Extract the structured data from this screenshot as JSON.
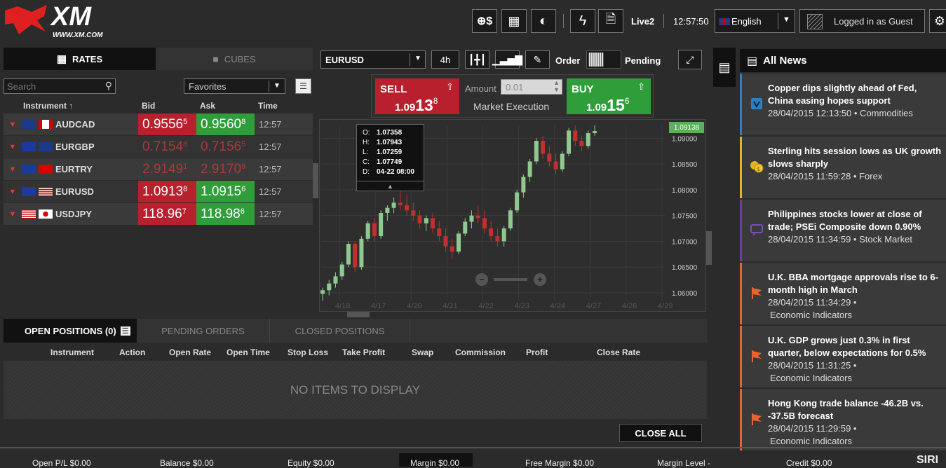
{
  "header": {
    "logo_text": "XM",
    "logo_url": "WWW.XM.COM",
    "account": "Live2",
    "clock": "12:57:50",
    "language": "English",
    "login_label": "Logged in as Guest"
  },
  "rates_panel": {
    "tab_rates": "RATES",
    "tab_cubes": "CUBES",
    "search_placeholder": "Search",
    "filter": "Favorites",
    "headers": {
      "instrument": "Instrument",
      "bid": "Bid",
      "ask": "Ask",
      "time": "Time"
    },
    "rows": [
      {
        "symbol": "AUDCAD",
        "bid_main": "0.9556",
        "bid_pip": "5",
        "ask_main": "0.9560",
        "ask_pip": "8",
        "time": "12:57",
        "active": true
      },
      {
        "symbol": "EURGBP",
        "bid_main": "0.7154",
        "bid_pip": "8",
        "ask_main": "0.7156",
        "ask_pip": "5",
        "time": "12:57",
        "active": false
      },
      {
        "symbol": "EURTRY",
        "bid_main": "2.9149",
        "bid_pip": "1",
        "ask_main": "2.9170",
        "ask_pip": "9",
        "time": "12:57",
        "active": false
      },
      {
        "symbol": "EURUSD",
        "bid_main": "1.0913",
        "bid_pip": "8",
        "ask_main": "1.0915",
        "ask_pip": "6",
        "time": "12:57",
        "active": true
      },
      {
        "symbol": "USDJPY",
        "bid_main": "118.96",
        "bid_pip": "7",
        "ask_main": "118.98",
        "ask_pip": "6",
        "time": "12:57",
        "active": true
      }
    ]
  },
  "chart_panel": {
    "symbol": "EURUSD",
    "timeframe": "4h",
    "order_label": "Order",
    "pending_label": "Pending",
    "sell": {
      "label": "SELL",
      "pre": "1.09",
      "big": "13",
      "pip": "8"
    },
    "buy": {
      "label": "BUY",
      "pre": "1.09",
      "big": "15",
      "pip": "6"
    },
    "amount_label": "Amount",
    "amount_value": "0.01",
    "execution": "Market Execution",
    "current_price": "1.09138",
    "tooltip": {
      "o": "1.07358",
      "h": "1.07943",
      "l": "1.07259",
      "c": "1.07749",
      "d": "04-22 08:00",
      "lo": "O:",
      "lh": "H:",
      "ll": "L:",
      "lc": "C:",
      "ld": "D:"
    }
  },
  "chart_data": {
    "type": "candlestick",
    "y_ticks": [
      "1.09000",
      "1.08500",
      "1.08000",
      "1.07500",
      "1.07000",
      "1.06500",
      "1.06000"
    ],
    "ylim": [
      1.0585,
      1.0925
    ],
    "x_ticks": [
      "4/18",
      "4/17",
      "4/20",
      "4/21",
      "4/22",
      "4/23",
      "4/24",
      "4/27",
      "4/28",
      "4/29"
    ],
    "ohlc": [
      [
        1.0598,
        1.061,
        1.0585,
        1.0605
      ],
      [
        1.0605,
        1.0625,
        1.0595,
        1.0618
      ],
      [
        1.0618,
        1.064,
        1.061,
        1.0632
      ],
      [
        1.0632,
        1.066,
        1.0625,
        1.0655
      ],
      [
        1.0655,
        1.07,
        1.065,
        1.0695
      ],
      [
        1.0695,
        1.07,
        1.064,
        1.065
      ],
      [
        1.065,
        1.071,
        1.0645,
        1.0705
      ],
      [
        1.0705,
        1.074,
        1.07,
        1.0735
      ],
      [
        1.0735,
        1.0745,
        1.07,
        1.071
      ],
      [
        1.071,
        1.076,
        1.0705,
        1.0755
      ],
      [
        1.0755,
        1.077,
        1.074,
        1.0765
      ],
      [
        1.0765,
        1.0785,
        1.0755,
        1.0775
      ],
      [
        1.0775,
        1.08,
        1.076,
        1.077
      ],
      [
        1.077,
        1.079,
        1.075,
        1.076
      ],
      [
        1.076,
        1.0775,
        1.074,
        1.075
      ],
      [
        1.075,
        1.076,
        1.0725,
        1.0735
      ],
      [
        1.0735,
        1.075,
        1.072,
        1.0745
      ],
      [
        1.0745,
        1.0755,
        1.0715,
        1.0725
      ],
      [
        1.0725,
        1.074,
        1.07,
        1.071
      ],
      [
        1.071,
        1.0725,
        1.068,
        1.069
      ],
      [
        1.069,
        1.0705,
        1.0665,
        1.068
      ],
      [
        1.068,
        1.072,
        1.0675,
        1.0715
      ],
      [
        1.0715,
        1.0745,
        1.071,
        1.0738
      ],
      [
        1.0738,
        1.076,
        1.0725,
        1.075
      ],
      [
        1.075,
        1.077,
        1.0735,
        1.0745
      ],
      [
        1.0745,
        1.076,
        1.0715,
        1.0725
      ],
      [
        1.0725,
        1.074,
        1.07,
        1.071
      ],
      [
        1.071,
        1.0725,
        1.069,
        1.07
      ],
      [
        1.07,
        1.073,
        1.069,
        1.0725
      ],
      [
        1.0725,
        1.0765,
        1.072,
        1.076
      ],
      [
        1.076,
        1.08,
        1.0755,
        1.0795
      ],
      [
        1.0795,
        1.083,
        1.0785,
        1.0825
      ],
      [
        1.0825,
        1.086,
        1.0815,
        1.0855
      ],
      [
        1.0855,
        1.09,
        1.085,
        1.0895
      ],
      [
        1.0895,
        1.0905,
        1.086,
        1.087
      ],
      [
        1.087,
        1.0885,
        1.0845,
        1.0855
      ],
      [
        1.0855,
        1.087,
        1.083,
        1.084
      ],
      [
        1.084,
        1.0875,
        1.0835,
        1.087
      ],
      [
        1.087,
        1.092,
        1.0865,
        1.0915
      ],
      [
        1.0915,
        1.0925,
        1.0885,
        1.0895
      ],
      [
        1.0895,
        1.0905,
        1.0875,
        1.0885
      ],
      [
        1.0885,
        1.0915,
        1.088,
        1.091
      ],
      [
        1.091,
        1.0925,
        1.0905,
        1.0914
      ]
    ]
  },
  "positions": {
    "tab_open": "OPEN POSITIONS (0)",
    "tab_pending": "PENDING ORDERS",
    "tab_closed": "CLOSED POSITIONS",
    "columns": [
      "Instrument",
      "Action",
      "Open Rate",
      "Open Time",
      "Stop Loss",
      "Take Profit",
      "Swap",
      "Commission",
      "Profit",
      "Close Rate"
    ],
    "empty": "NO ITEMS TO DISPLAY",
    "close_all": "CLOSE ALL"
  },
  "news": {
    "title": "All News",
    "items": [
      {
        "title": "Copper dips slightly ahead of Fed, China easing hopes support",
        "meta": "28/04/2015 12:13:50 • Commodities",
        "color": "#2c7fc2",
        "icon": "commodities-icon"
      },
      {
        "title": "Sterling hits session lows as UK growth slows sharply",
        "meta": "28/04/2015 11:59:28 • Forex",
        "color": "#e6b422",
        "icon": "forex-coins-icon"
      },
      {
        "title": "Philippines stocks lower at close of trade; PSEi Composite down 0.90%",
        "meta": "28/04/2015 11:34:59 • Stock Market",
        "color": "#6b3fa0",
        "icon": "stock-market-icon"
      },
      {
        "title": "U.K. BBA mortgage approvals rise to 6-month high in March",
        "meta": "28/04/2015 11:34:29 •",
        "meta2": "Economic Indicators",
        "color": "#e8642c",
        "icon": "flag-icon"
      },
      {
        "title": "U.K. GDP grows just 0.3% in first quarter, below expectations for 0.5%",
        "meta": "28/04/2015 11:31:25 •",
        "meta2": "Economic Indicators",
        "color": "#e8642c",
        "icon": "flag-icon"
      },
      {
        "title": "Hong Kong trade balance -46.2B vs. -37.5B forecast",
        "meta": "28/04/2015 11:29:59 •",
        "meta2": "Economic Indicators",
        "color": "#e8642c",
        "icon": "flag-icon"
      }
    ]
  },
  "footer": {
    "open_pl": "Open P/L $0.00",
    "balance": "Balance $0.00",
    "equity": "Equity $0.00",
    "margin": "Margin $0.00",
    "free_margin": "Free Margin $0.00",
    "margin_level": "Margin Level -",
    "credit": "Credit $0.00",
    "brand": "SIRI"
  }
}
